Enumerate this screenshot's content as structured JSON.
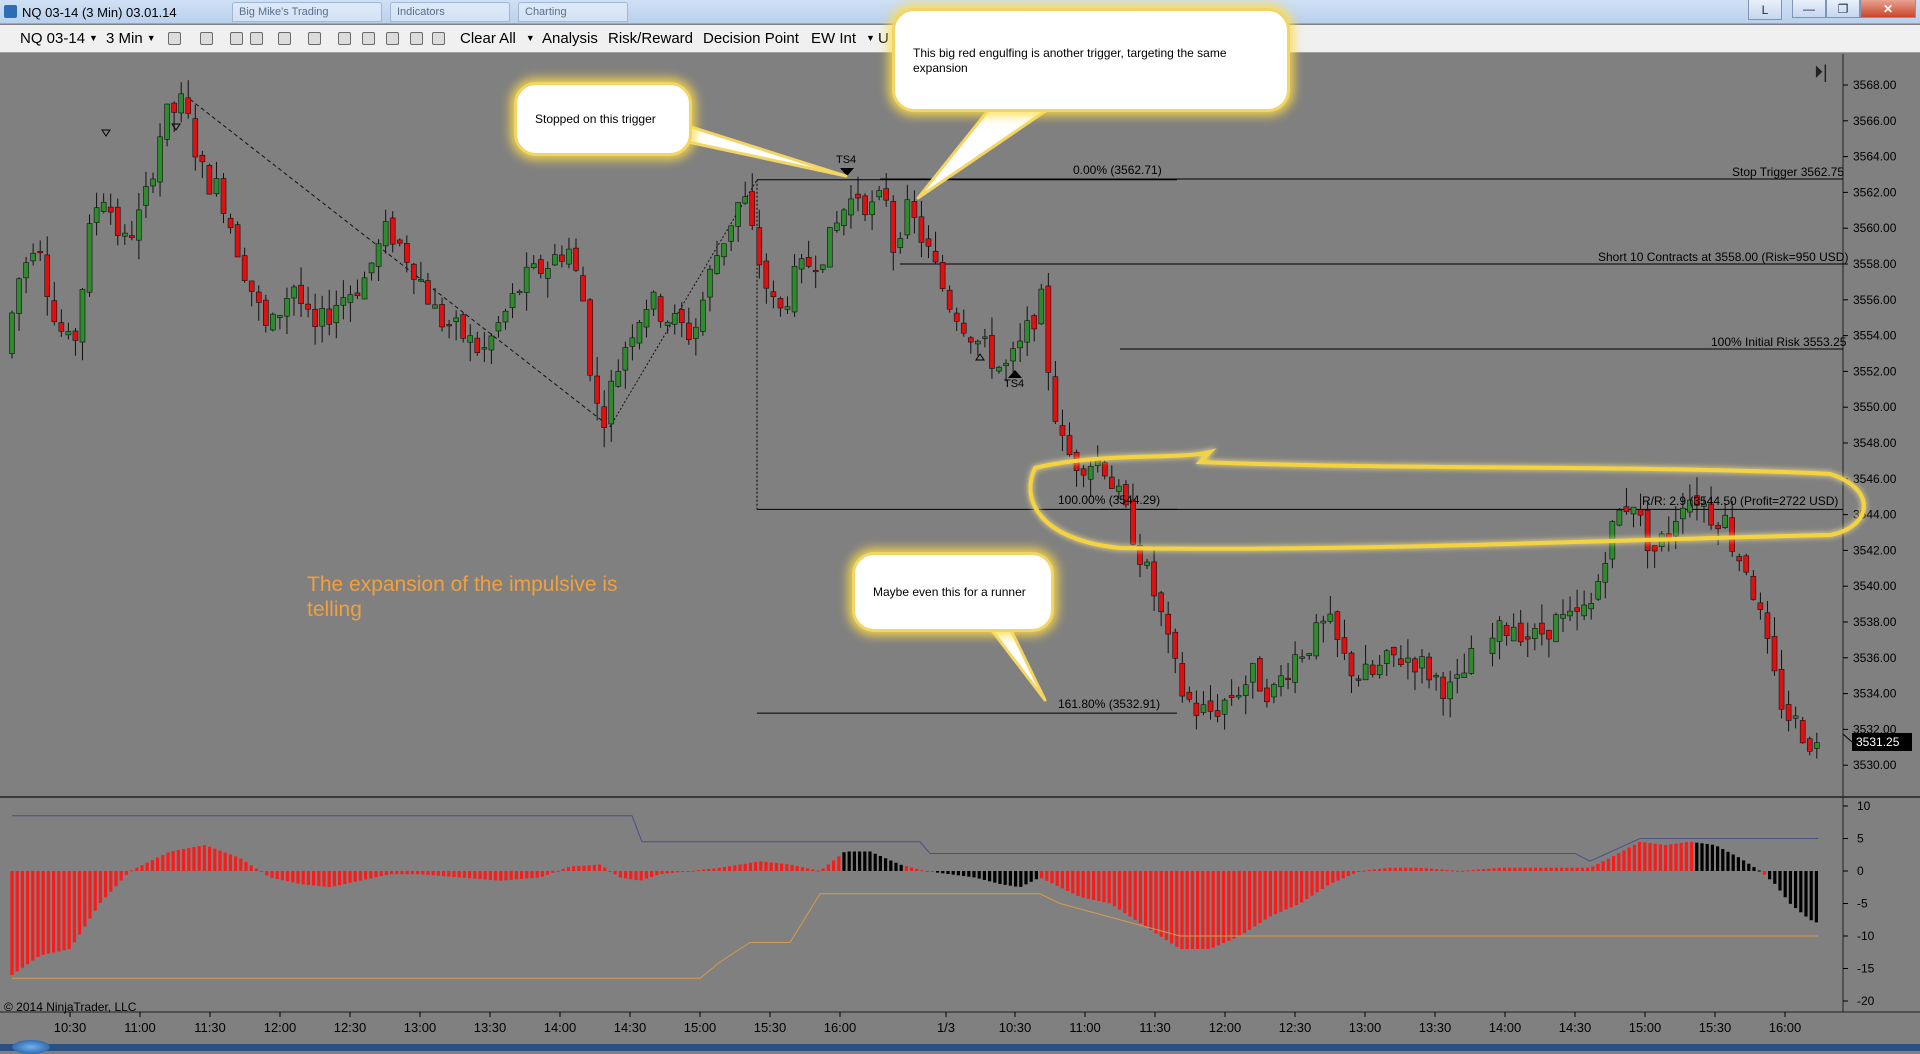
{
  "window": {
    "title": "NQ 03-14 (3 Min)  03.01.14",
    "ghost_tabs": [
      "Big Mike's Trading",
      "Indicators",
      "Charting"
    ],
    "help_button": "L",
    "minimize_glyph": "—",
    "restore_glyph": "❐",
    "close_glyph": "✕"
  },
  "toolbar": {
    "instrument": "NQ 03-14",
    "interval": "3 Min",
    "menus": [
      "Clear All",
      "Analysis",
      "Risk/Reward",
      "Decision Point",
      "EW Int",
      "U"
    ]
  },
  "chart": {
    "price_axis_ticks": [
      "3568.00",
      "3566.00",
      "3564.00",
      "3562.00",
      "3560.00",
      "3558.00",
      "3556.00",
      "3554.00",
      "3552.00",
      "3550.00",
      "3548.00",
      "3546.00",
      "3544.00",
      "3542.00",
      "3540.00",
      "3538.00",
      "3536.00",
      "3534.00",
      "3532.00",
      "3530.00"
    ],
    "last_price": "3531.25",
    "time_axis_ticks": [
      "10:30",
      "11:00",
      "11:30",
      "12:00",
      "12:30",
      "13:00",
      "13:30",
      "14:00",
      "14:30",
      "15:00",
      "15:30",
      "16:00",
      "1/3",
      "10:30",
      "11:00",
      "11:30",
      "12:00",
      "12:30",
      "13:00",
      "13:30",
      "14:00",
      "14:30",
      "15:00",
      "15:30",
      "16:00"
    ],
    "fib_labels": [
      "0.00% (3562.71)",
      "100.00% (3544.29)",
      "161.80% (3532.91)"
    ],
    "level_labels": [
      "Stop Trigger 3562.75",
      "Short 10 Contracts at 3558.00 (Risk=950 USD)",
      "100% Initial Risk 3553.25",
      "R/R: 2.9 (3544.50 (Profit=2722 USD)"
    ],
    "ts_labels": [
      "TS4",
      "TS4"
    ],
    "callouts": [
      "This big red engulfing is another trigger, targeting the same expansion",
      "Stopped on this trigger",
      "Maybe even this for a runner"
    ],
    "note": "The expansion of the impulsive is telling",
    "copyright": "© 2014 NinjaTrader, LLC"
  },
  "oscillator": {
    "axis_ticks": [
      "10",
      "5",
      "0",
      "-5",
      "-10",
      "-15",
      "-20"
    ]
  },
  "colors": {
    "background": "#808080",
    "up_candle": "#2e8b2e",
    "down_candle": "#e01010",
    "hist_red": "#ff1a1a",
    "hist_black": "#000000",
    "highlight": "#f5d33f",
    "note": "#f0a03c"
  }
}
